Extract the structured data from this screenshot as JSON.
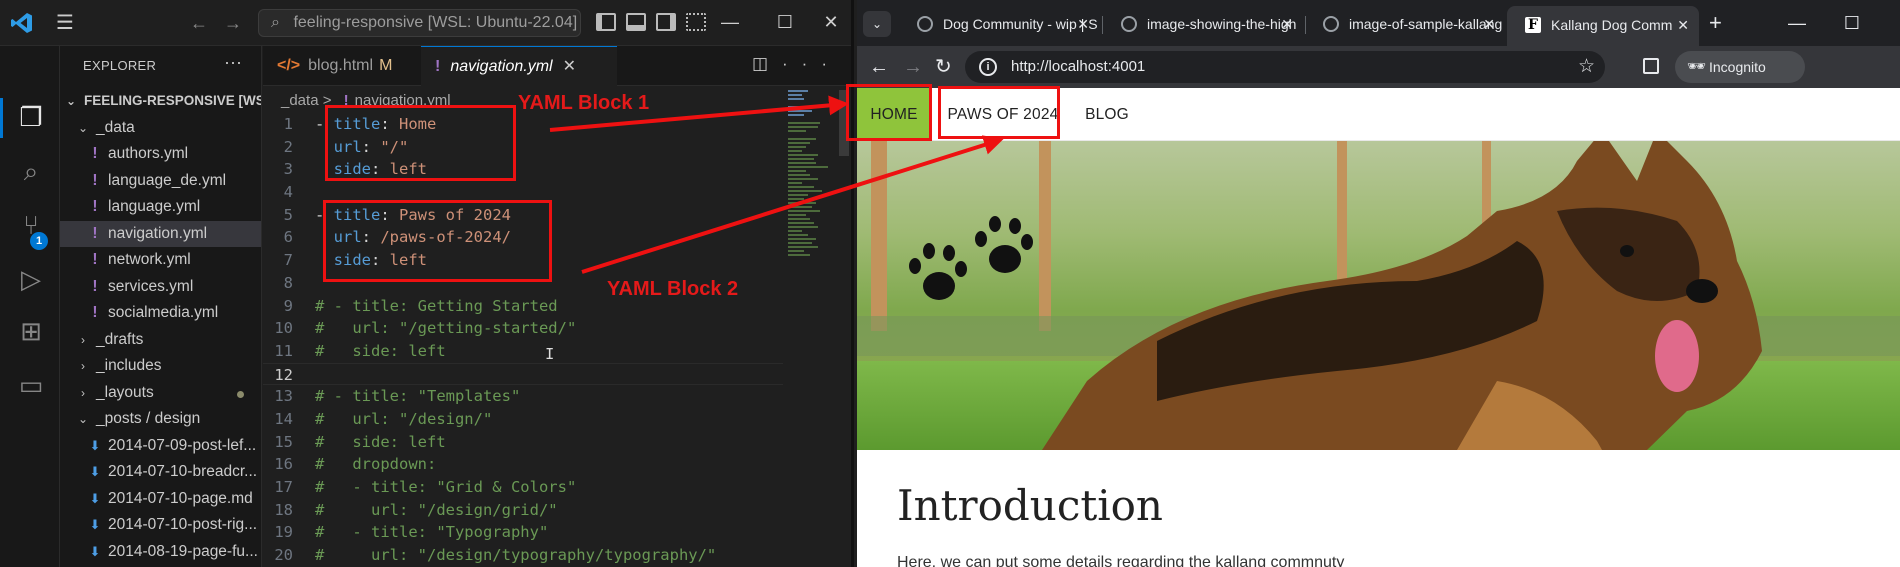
{
  "vscode": {
    "search_text": "feeling-responsive [WSL: Ubuntu-22.04]",
    "explorer_title": "EXPLORER",
    "badge_count": "1",
    "tree": [
      {
        "label": "FEELING-RESPONSIVE [WS...",
        "type": "root",
        "indent": 0
      },
      {
        "label": "_data",
        "type": "folder-open",
        "indent": 1
      },
      {
        "label": "authors.yml",
        "type": "yml",
        "indent": 2
      },
      {
        "label": "language_de.yml",
        "type": "yml",
        "indent": 2
      },
      {
        "label": "language.yml",
        "type": "yml",
        "indent": 2
      },
      {
        "label": "navigation.yml",
        "type": "yml",
        "indent": 2,
        "selected": true
      },
      {
        "label": "network.yml",
        "type": "yml",
        "indent": 2
      },
      {
        "label": "services.yml",
        "type": "yml",
        "indent": 2
      },
      {
        "label": "socialmedia.yml",
        "type": "yml",
        "indent": 2
      },
      {
        "label": "_drafts",
        "type": "folder",
        "indent": 1
      },
      {
        "label": "_includes",
        "type": "folder",
        "indent": 1
      },
      {
        "label": "_layouts",
        "type": "folder",
        "indent": 1,
        "dot": true
      },
      {
        "label": "_posts / design",
        "type": "folder-open",
        "indent": 1
      },
      {
        "label": "2014-07-09-post-lef...",
        "type": "md",
        "indent": 2
      },
      {
        "label": "2014-07-10-breadcr...",
        "type": "md",
        "indent": 2
      },
      {
        "label": "2014-07-10-page.md",
        "type": "md",
        "indent": 2
      },
      {
        "label": "2014-07-10-post-rig...",
        "type": "md",
        "indent": 2
      },
      {
        "label": "2014-08-19-page-fu...",
        "type": "md",
        "indent": 2
      }
    ],
    "tabs": [
      {
        "label": "blog.html",
        "modified": "M"
      },
      {
        "label": "navigation.yml",
        "close": "✕"
      }
    ],
    "breadcrumb": {
      "folder": "_data",
      "sep": ">",
      "file": "navigation.yml"
    },
    "code_lines": [
      {
        "n": "1",
        "tokens": [
          [
            "p",
            "- "
          ],
          [
            "k",
            "title"
          ],
          [
            "p",
            ": "
          ],
          [
            "v",
            "Home"
          ]
        ]
      },
      {
        "n": "2",
        "tokens": [
          [
            "p",
            "  "
          ],
          [
            "k",
            "url"
          ],
          [
            "p",
            ": "
          ],
          [
            "v",
            "\"/\""
          ]
        ]
      },
      {
        "n": "3",
        "tokens": [
          [
            "p",
            "  "
          ],
          [
            "k",
            "side"
          ],
          [
            "p",
            ": "
          ],
          [
            "v",
            "left"
          ]
        ]
      },
      {
        "n": "4",
        "tokens": []
      },
      {
        "n": "5",
        "tokens": [
          [
            "p",
            "- "
          ],
          [
            "k",
            "title"
          ],
          [
            "p",
            ": "
          ],
          [
            "v",
            "Paws of 2024"
          ]
        ]
      },
      {
        "n": "6",
        "tokens": [
          [
            "p",
            "  "
          ],
          [
            "k",
            "url"
          ],
          [
            "p",
            ": "
          ],
          [
            "v",
            "/paws-of-2024/"
          ]
        ]
      },
      {
        "n": "7",
        "tokens": [
          [
            "p",
            "  "
          ],
          [
            "k",
            "side"
          ],
          [
            "p",
            ": "
          ],
          [
            "v",
            "left"
          ]
        ]
      },
      {
        "n": "8",
        "tokens": []
      },
      {
        "n": "9",
        "tokens": [
          [
            "c",
            "# - title: Getting Started"
          ]
        ]
      },
      {
        "n": "10",
        "tokens": [
          [
            "c",
            "#   url: \"/getting-started/\""
          ]
        ]
      },
      {
        "n": "11",
        "tokens": [
          [
            "c",
            "#   side: left"
          ]
        ]
      },
      {
        "n": "12",
        "tokens": [],
        "current": true
      },
      {
        "n": "13",
        "tokens": [
          [
            "c",
            "# - title: \"Templates\""
          ]
        ]
      },
      {
        "n": "14",
        "tokens": [
          [
            "c",
            "#   url: \"/design/\""
          ]
        ]
      },
      {
        "n": "15",
        "tokens": [
          [
            "c",
            "#   side: left"
          ]
        ]
      },
      {
        "n": "16",
        "tokens": [
          [
            "c",
            "#   dropdown:"
          ]
        ]
      },
      {
        "n": "17",
        "tokens": [
          [
            "c",
            "#   - title: \"Grid & Colors\""
          ]
        ]
      },
      {
        "n": "18",
        "tokens": [
          [
            "c",
            "#     url: \"/design/grid/\""
          ]
        ]
      },
      {
        "n": "19",
        "tokens": [
          [
            "c",
            "#   - title: \"Typography\""
          ]
        ]
      },
      {
        "n": "20",
        "tokens": [
          [
            "c",
            "#     url: \"/design/typography/typography/\""
          ]
        ]
      }
    ]
  },
  "browser": {
    "tabs": [
      {
        "label": "Dog Community - wip | S"
      },
      {
        "label": "image-showing-the-high"
      },
      {
        "label": "image-of-sample-kallang"
      },
      {
        "label": "Kallang Dog Comm",
        "active": true,
        "favicon": "F"
      }
    ],
    "url": "http://localhost:4001",
    "incognito_label": "Incognito",
    "site": {
      "nav": [
        {
          "label": "HOME"
        },
        {
          "label": "PAWS OF 2024"
        },
        {
          "label": "BLOG"
        }
      ],
      "heading": "Introduction",
      "paragraph": "Here, we can put some details regarding the kallang commnuty"
    }
  },
  "annotations": {
    "block1_label": "YAML Block 1",
    "block2_label": "YAML Block 2",
    "color": "#e11b1b"
  },
  "colors": {
    "home_nav_bg": "#8fc43b",
    "vscode_accent": "#0078d4",
    "yaml_key": "#569cd6",
    "yaml_value": "#ce9178",
    "comment": "#6a9955"
  }
}
